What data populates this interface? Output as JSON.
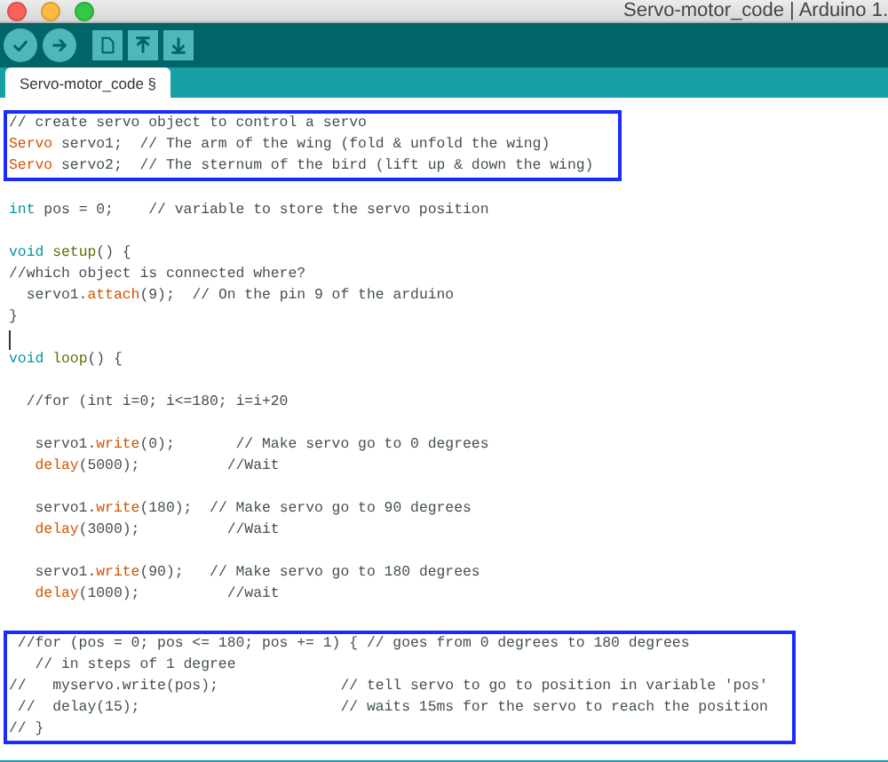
{
  "window": {
    "title": "Servo-motor_code | Arduino 1."
  },
  "tabs": [
    {
      "label": "Servo-motor_code §",
      "selected": true
    }
  ],
  "editor": {
    "blocks": [
      {
        "boxed": true,
        "paragraphs": [
          {
            "lines": [
              {
                "tokens": [
                  {
                    "kind": "comment",
                    "text": "// create servo object to control a servo"
                  }
                ]
              },
              {
                "tokens": [
                  {
                    "kind": "builtin",
                    "text": "Servo"
                  },
                  {
                    "kind": "plain",
                    "text": " servo1;  // The arm of the wing (fold & unfold the wing)"
                  }
                ]
              },
              {
                "tokens": [
                  {
                    "kind": "builtin",
                    "text": "Servo"
                  },
                  {
                    "kind": "plain",
                    "text": " servo2;  // The sternum of the bird (lift up & down the wing)"
                  }
                ]
              }
            ]
          }
        ]
      },
      {
        "boxed": false,
        "paragraphs": [
          {
            "lines": [
              {
                "tokens": [
                  {
                    "kind": "keyword",
                    "text": "int"
                  },
                  {
                    "kind": "plain",
                    "text": " pos = 0;    // variable to store the servo position"
                  }
                ]
              }
            ]
          },
          {
            "lines": [
              {
                "tokens": [
                  {
                    "kind": "keyword",
                    "text": "void "
                  },
                  {
                    "kind": "function",
                    "text": "setup"
                  },
                  {
                    "kind": "plain",
                    "text": "() {"
                  }
                ]
              },
              {
                "tokens": [
                  {
                    "kind": "plain",
                    "text": "//which object is connected where?"
                  }
                ]
              },
              {
                "tokens": [
                  {
                    "kind": "plain",
                    "text": "  servo1."
                  },
                  {
                    "kind": "builtin",
                    "text": "attach"
                  },
                  {
                    "kind": "plain",
                    "text": "(9);  // On the pin 9 of the arduino"
                  }
                ]
              },
              {
                "tokens": [
                  {
                    "kind": "plain",
                    "text": "}"
                  }
                ]
              },
              {
                "cursor": true
              },
              {
                "tokens": [
                  {
                    "kind": "keyword",
                    "text": "void "
                  },
                  {
                    "kind": "function",
                    "text": "loop"
                  },
                  {
                    "kind": "plain",
                    "text": "() {"
                  }
                ]
              }
            ]
          },
          {
            "lines": [
              {
                "tokens": [
                  {
                    "kind": "plain",
                    "text": "  //for (int i=0; i<=180; i=i+20"
                  }
                ]
              }
            ]
          },
          {
            "lines": [
              {
                "tokens": [
                  {
                    "kind": "plain",
                    "text": "   servo1."
                  },
                  {
                    "kind": "builtin",
                    "text": "write"
                  },
                  {
                    "kind": "plain",
                    "text": "(0);       // Make servo go to 0 degrees"
                  }
                ]
              },
              {
                "tokens": [
                  {
                    "kind": "builtin",
                    "text": "   delay"
                  },
                  {
                    "kind": "plain",
                    "text": "(5000);          //Wait"
                  }
                ]
              }
            ]
          },
          {
            "lines": [
              {
                "tokens": [
                  {
                    "kind": "plain",
                    "text": "   servo1."
                  },
                  {
                    "kind": "builtin",
                    "text": "write"
                  },
                  {
                    "kind": "plain",
                    "text": "(180);  // Make servo go to 90 degrees"
                  }
                ]
              },
              {
                "tokens": [
                  {
                    "kind": "builtin",
                    "text": "   delay"
                  },
                  {
                    "kind": "plain",
                    "text": "(3000);          //Wait"
                  }
                ]
              }
            ]
          },
          {
            "lines": [
              {
                "tokens": [
                  {
                    "kind": "plain",
                    "text": "   servo1."
                  },
                  {
                    "kind": "builtin",
                    "text": "write"
                  },
                  {
                    "kind": "plain",
                    "text": "(90);   // Make servo go to 180 degrees"
                  }
                ]
              },
              {
                "tokens": [
                  {
                    "kind": "builtin",
                    "text": "   delay"
                  },
                  {
                    "kind": "plain",
                    "text": "(1000);          //wait"
                  }
                ]
              }
            ]
          }
        ]
      },
      {
        "boxed": true,
        "paragraphs": [
          {
            "lines": [
              {
                "tokens": [
                  {
                    "kind": "plain",
                    "text": " //for (pos = 0; pos <= 180; pos += 1) { // goes from 0 degrees to 180 degrees"
                  }
                ]
              },
              {
                "tokens": [
                  {
                    "kind": "plain",
                    "text": "   // in steps of 1 degree"
                  }
                ]
              },
              {
                "tokens": [
                  {
                    "kind": "plain",
                    "text": "//   myservo.write(pos);              // tell servo to go to position in variable 'pos'"
                  }
                ]
              },
              {
                "tokens": [
                  {
                    "kind": "plain",
                    "text": " //  delay(15);                       // waits 15ms for the servo to reach the position"
                  }
                ]
              },
              {
                "tokens": [
                  {
                    "kind": "plain",
                    "text": "// }"
                  }
                ]
              }
            ]
          }
        ]
      }
    ]
  }
}
